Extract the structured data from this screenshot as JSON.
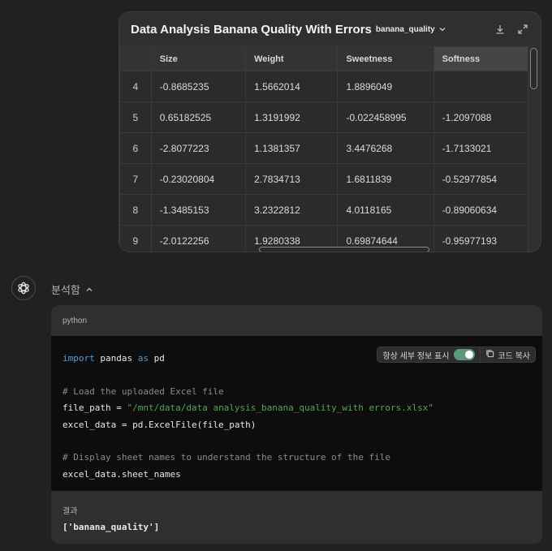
{
  "table_card": {
    "title": "Data Analysis Banana Quality With Errors",
    "sheet_name": "banana_quality",
    "columns": [
      "",
      "Size",
      "Weight",
      "Sweetness",
      "Softness"
    ],
    "rows": [
      [
        "4",
        "-0.8685235",
        "1.5662014",
        "1.8896049",
        ""
      ],
      [
        "5",
        "0.65182525",
        "1.3191992",
        "-0.022458995",
        "-1.2097088"
      ],
      [
        "6",
        "-2.8077223",
        "1.1381357",
        "3.4476268",
        "-1.7133021"
      ],
      [
        "7",
        "-0.23020804",
        "2.7834713",
        "1.6811839",
        "-0.52977854"
      ],
      [
        "8",
        "-1.3485153",
        "3.2322812",
        "4.0118165",
        "-0.89060634"
      ],
      [
        "9",
        "-2.0122256",
        "1.9280338",
        "0.69874644",
        "-0.95977193"
      ]
    ],
    "icons": {
      "download": "download-icon",
      "expand": "expand-icon",
      "chevron": "chevron-down-icon"
    }
  },
  "assistant": {
    "analysis_label": "분석함",
    "icons": {
      "avatar": "openai-logo-icon",
      "toggle": "chevron-up-icon"
    }
  },
  "code_block": {
    "language": "python",
    "always_show_details_label": "항상 세부 정보 표시",
    "copy_label": "코드 복사",
    "toggle_on": true,
    "lines": [
      "import pandas as pd",
      "",
      "# Load the uploaded Excel file",
      "file_path = \"/mnt/data/data analysis_banana_quality_with errors.xlsx\"",
      "excel_data = pd.ExcelFile(file_path)",
      "",
      "# Display sheet names to understand the structure of the file",
      "excel_data.sheet_names"
    ],
    "result_label": "결과",
    "result_value": "['banana_quality']"
  },
  "colors": {
    "background": "#212121",
    "card": "#2f2f2f",
    "code_background": "#0d0d0d",
    "keyword": "#569cd6",
    "string": "#56a35a",
    "comment": "#8b8b8b",
    "toggle_on": "#5b9a78"
  }
}
